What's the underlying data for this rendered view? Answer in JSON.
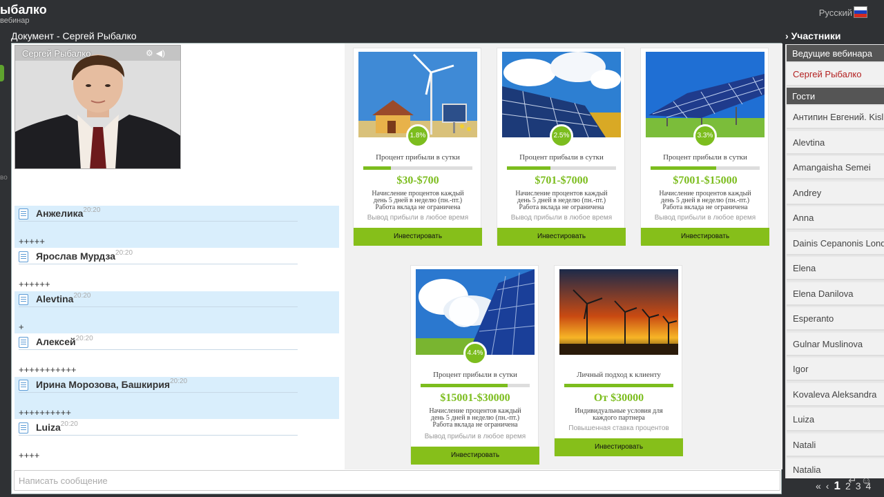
{
  "app": {
    "brand_title": "ыбалко",
    "brand_sub": "вебинар",
    "language": "Русский",
    "flag_colors": [
      "#ffffff",
      "#1c3fbf",
      "#d52b1e"
    ]
  },
  "left_strip": {
    "text": "во"
  },
  "document": {
    "title": "Документ - Сергей Рыбалко"
  },
  "video": {
    "name": "Сергей Рыбалко",
    "icons": [
      "settings-icon",
      "speaker-icon"
    ]
  },
  "chat": {
    "messages": [
      {
        "author": "Анжелика",
        "time": "20:20",
        "text": "+++++",
        "highlight": true
      },
      {
        "author": "Ярослав Мурдза",
        "time": "20:20",
        "text": "++++++",
        "highlight": false
      },
      {
        "author": "Alevtina",
        "time": "20:20",
        "text": "+",
        "highlight": true
      },
      {
        "author": "Алексей",
        "time": "20:20",
        "text": "+++++++++++",
        "highlight": false
      },
      {
        "author": "Ирина Морозова, Башкирия",
        "time": "20:20",
        "text": "++++++++++",
        "highlight": true
      },
      {
        "author": "Luiza",
        "time": "20:20",
        "text": "++++",
        "highlight": false
      }
    ],
    "input_placeholder": "Написать сообщение"
  },
  "cards": [
    {
      "badge": "1.8%",
      "subtitle": "Процент прибыли в сутки",
      "progress": 0.25,
      "price": "$30-$700",
      "desc": "Начисление процентов каждый день 5 дней в неделю (пн.-пт.) Работа вклада не ограничена",
      "note": "Вывод прибыли в любое время",
      "button": "Инвестировать"
    },
    {
      "badge": "2.5%",
      "subtitle": "Процент прибыли в сутки",
      "progress": 0.4,
      "price": "$701-$7000",
      "desc": "Начисление процентов каждый день 5 дней в неделю (пн.-пт.) Работа вклада не ограничена",
      "note": "Вывод прибыли в любое время",
      "button": "Инвестировать"
    },
    {
      "badge": "3.3%",
      "subtitle": "Процент прибыли в сутки",
      "progress": 0.6,
      "price": "$7001-$15000",
      "desc": "Начисление процентов каждый день 5 дней в неделю (пн.-пт.) Работа вклада не ограничена",
      "note": "Вывод прибыли в любое время",
      "button": "Инвестировать"
    },
    {
      "badge": "4.4%",
      "subtitle": "Процент прибыли в сутки",
      "progress": 0.8,
      "price": "$15001-$30000",
      "desc": "Начисление процентов каждый день 5 дней в неделю (пн.-пт.) Работа вклада не ограничена",
      "note": "Вывод прибыли в любое время",
      "button": "Инвестировать"
    },
    {
      "badge": "",
      "subtitle": "Личный подход к клиенту",
      "progress": 1.0,
      "price": "От $30000",
      "desc": "Индивидуальные условия для каждого партнера",
      "note": "Повышенная ставка процентов",
      "button": "Инвестировать"
    }
  ],
  "participants": {
    "title": "Участники",
    "hosts_label": "Ведущие вебинара",
    "hosts": [
      "Сергей Рыбалко"
    ],
    "guests_label": "Гости",
    "guests": [
      "Антипин Евгений. Kisl",
      "Alevtina",
      "Amangaisha Semei",
      "Andrey",
      "Anna",
      "Dainis Cepanonis Londo",
      "Elena",
      "Elena Danilova",
      "Esperanto",
      "Gulnar Muslinova",
      "Igor",
      "Kovaleva Aleksandra",
      "Luiza",
      "Natali",
      "Natalia"
    ],
    "pager": {
      "first": "«",
      "prev": "‹",
      "pages": [
        "1",
        "2",
        "3",
        "4"
      ],
      "current": "1"
    }
  }
}
